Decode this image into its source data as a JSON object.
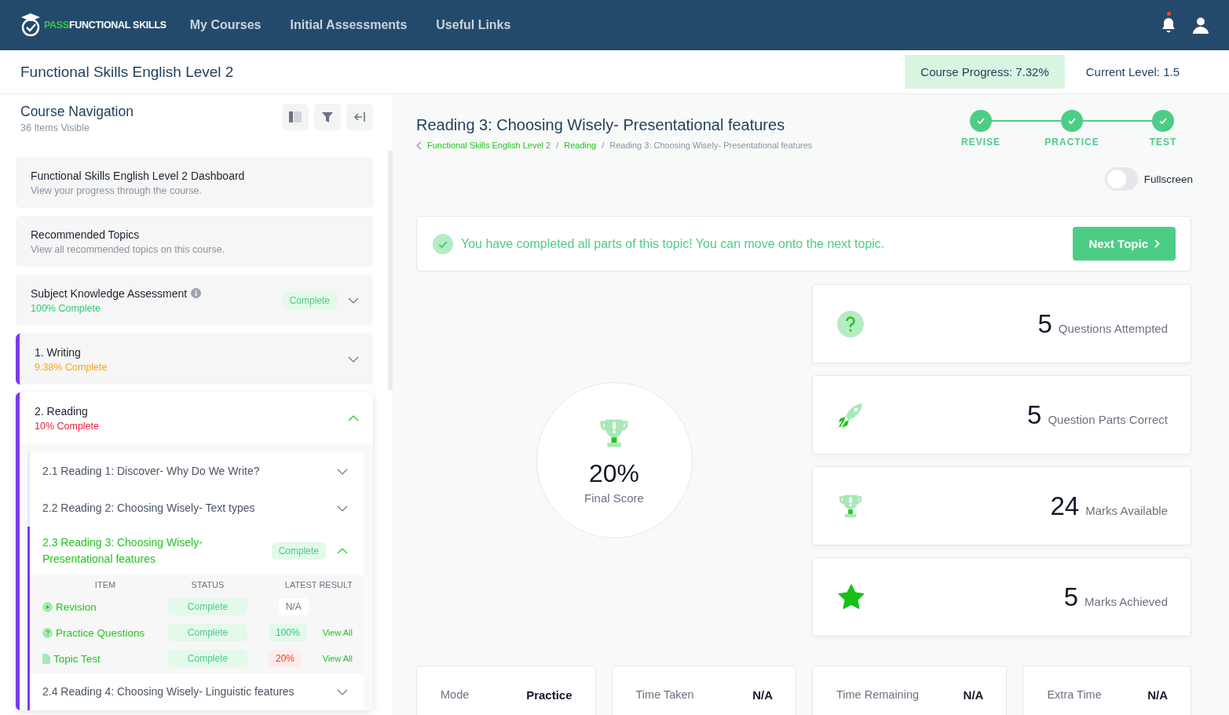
{
  "nav": {
    "logo_accent": "PASS",
    "logo_text": "FUNCTIONAL SKILLS",
    "links": [
      "My Courses",
      "Initial Assessments",
      "Useful Links"
    ],
    "has_notification": true
  },
  "course": {
    "title": "Functional Skills English Level 2",
    "progress": "Course Progress: 7.32%",
    "progress_highlighted": true,
    "level": "Current Level: 1.5"
  },
  "sidebar": {
    "title": "Course Navigation",
    "subtitle": "36 Items Visible",
    "items": [
      {
        "kind": "link",
        "title": "Functional Skills English Level 2 Dashboard",
        "subtitle": "View your progress through the course."
      },
      {
        "kind": "link",
        "title": "Recommended Topics",
        "subtitle": "View all recommended topics on this course."
      },
      {
        "kind": "assessment",
        "title": "Subject Knowledge Assessment",
        "progress": "100% Complete",
        "color": "#2ecc71",
        "badge": "Complete",
        "expanded": false
      },
      {
        "kind": "section",
        "title": "1. Writing",
        "progress": "9.38% Complete",
        "color": "#f5a623",
        "expanded": false
      },
      {
        "kind": "section",
        "title": "2. Reading",
        "progress": "10% Complete",
        "color": "#f0203a",
        "expanded": true,
        "children": [
          {
            "title": "2.1 Reading 1: Discover- Why Do We Write?",
            "selected": false,
            "expanded": false
          },
          {
            "title": "2.2 Reading 2: Choosing Wisely- Text types",
            "selected": false,
            "expanded": false
          },
          {
            "title": "2.3 Reading 3: Choosing Wisely- Presentational features",
            "selected": true,
            "expanded": true,
            "badge": "Complete",
            "columns": [
              "ITEM",
              "STATUS",
              "LATEST RESULT"
            ],
            "rows": [
              {
                "item": "Revision",
                "status": "Complete",
                "result": {
                  "text": "N/A",
                  "color": "#6b7280"
                }
              },
              {
                "item": "Practice Questions",
                "status": "Complete",
                "result": {
                  "text": "100%",
                  "color": "#2ecc71"
                },
                "link": "View All"
              },
              {
                "item": "Topic Test",
                "status": "Complete",
                "result": {
                  "text": "20%",
                  "color": "#f03a2a"
                },
                "link": "View All"
              }
            ]
          },
          {
            "title": "2.4 Reading 4: Choosing Wisely- Linguistic features",
            "selected": true,
            "expanded": false
          }
        ]
      }
    ]
  },
  "main": {
    "title": "Reading 3: Choosing Wisely- Presentational features",
    "breadcrumb_separator": "/",
    "breadcrumbs": [
      "Functional Skills English Level 2",
      "Reading",
      "Reading 3: Choosing Wisely- Presentational features"
    ],
    "steps": [
      {
        "label": "REVISE",
        "done": true
      },
      {
        "label": "PRACTICE",
        "done": true
      },
      {
        "label": "TEST",
        "done": true
      }
    ],
    "fullscreen": {
      "label": "Fullscreen",
      "on": false
    },
    "alert": {
      "message": "You have completed all parts of this topic! You can move onto the next topic.",
      "button": "Next Topic"
    },
    "score": {
      "value": "20%",
      "label": "Final Score"
    },
    "stats": [
      {
        "value": "5",
        "label": "Questions Attempted"
      },
      {
        "value": "5",
        "label": "Question Parts Correct"
      },
      {
        "value": "24",
        "label": "Marks Available"
      },
      {
        "value": "5",
        "label": "Marks Achieved"
      }
    ],
    "info": [
      {
        "label": "Mode",
        "value": "Practice"
      },
      {
        "label": "Time Taken",
        "value": "N/A"
      },
      {
        "label": "Time Remaining",
        "value": "N/A"
      },
      {
        "label": "Extra Time",
        "value": "N/A"
      }
    ]
  }
}
